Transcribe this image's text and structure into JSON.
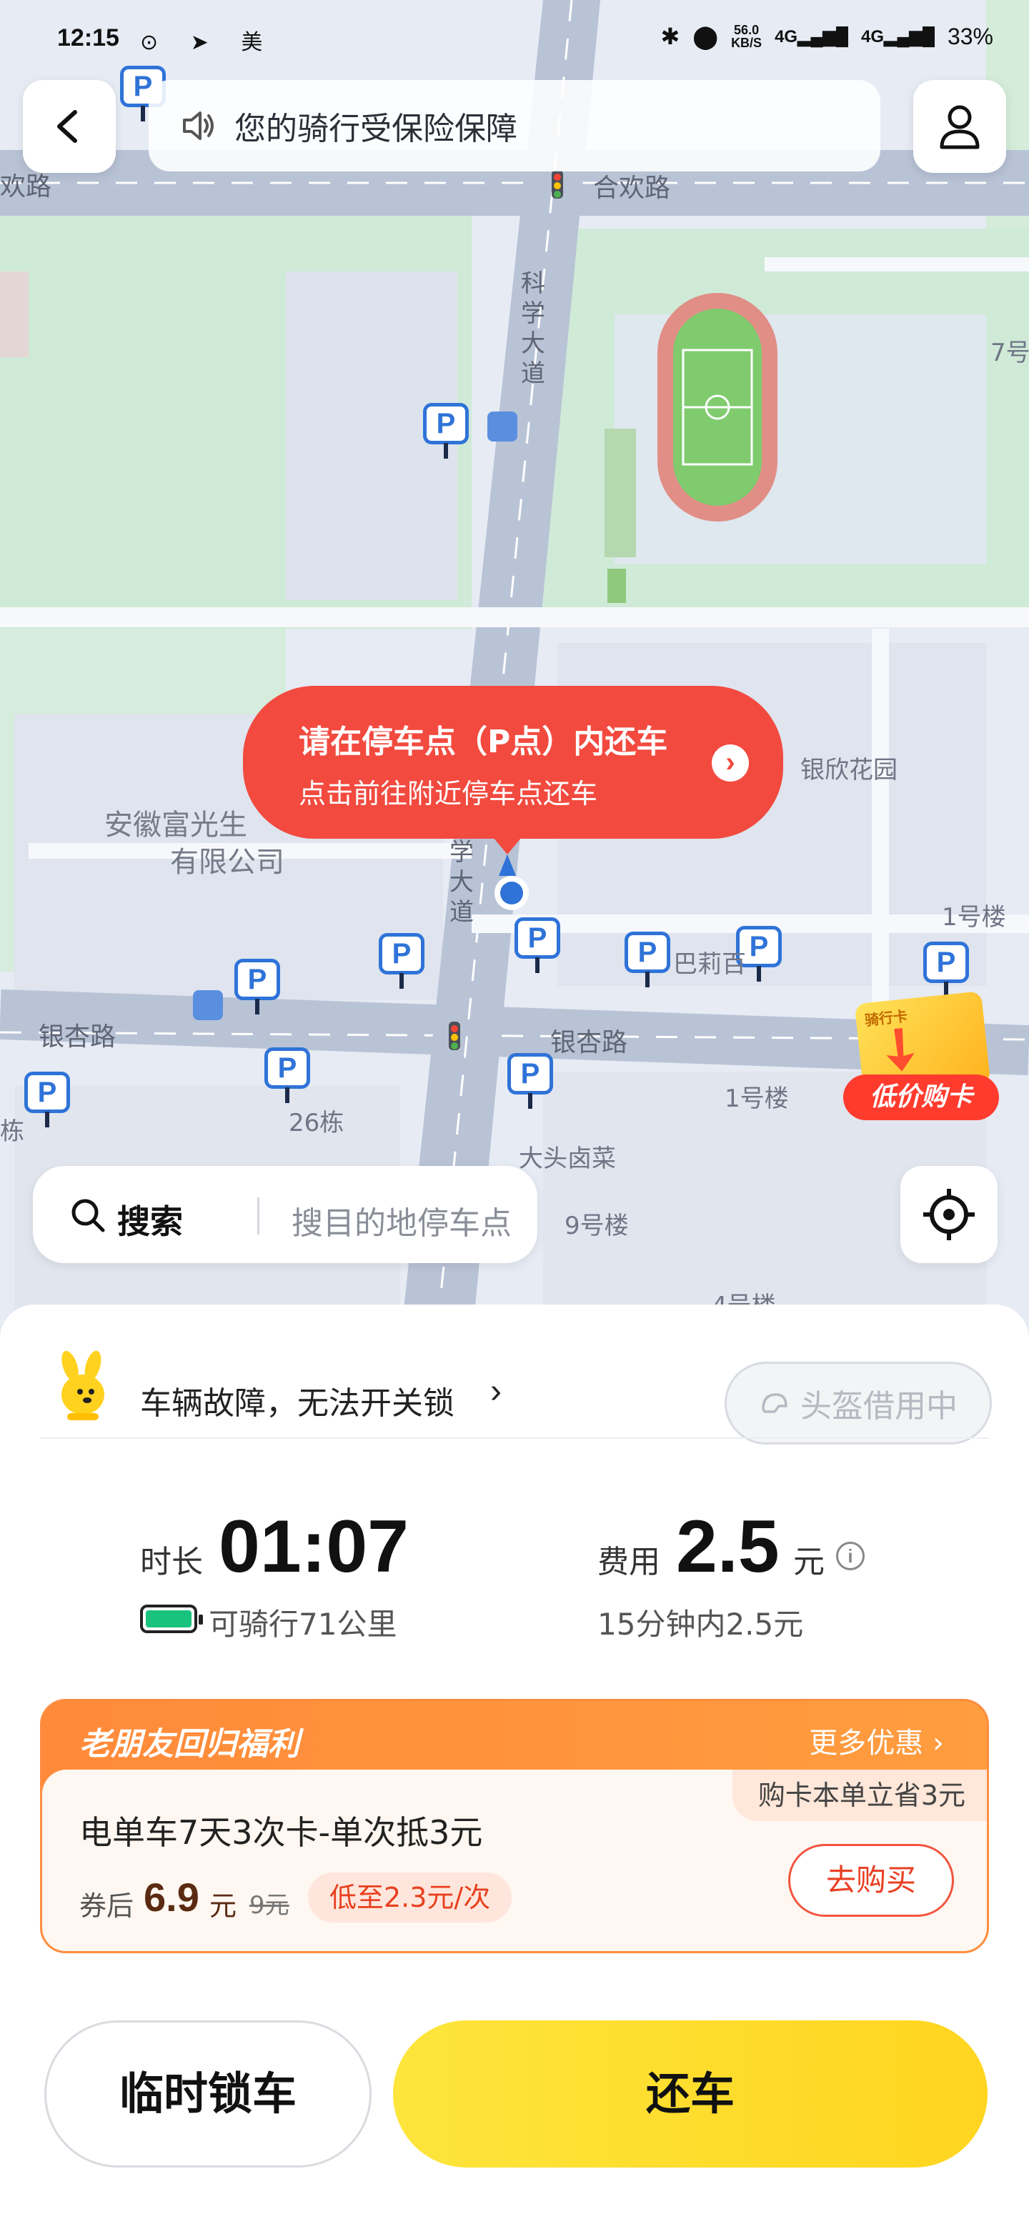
{
  "status_bar": {
    "time": "12:15",
    "app_icons": "⊙ ➤ 美",
    "net_speed": "56.0",
    "net_unit": "KB/S",
    "signal1": "4G",
    "signal2": "4G",
    "battery": "33%"
  },
  "top": {
    "notice_text": "您的骑行受保险保障"
  },
  "map": {
    "road_labels": {
      "hehuan_road": "合欢路",
      "hehuan_road_left": "欢路",
      "yinxing_road_left": "银杏路",
      "yinxing_road_center": "银杏路",
      "kexue_avenue_top": "科学大道",
      "kexue_avenue_mid": "学大道"
    },
    "place_labels": {
      "company_line1": "安徽富光生",
      "company_line2": "有限公司",
      "garden": "银欣花园",
      "bali": "巴莉百",
      "bldg_1_right": "1号楼",
      "bldg_1_lower": "1号楼",
      "bldg_26": "26栋",
      "bldg_9": "9号楼",
      "bldg_4": "4号楼",
      "bldg_7": "7号",
      "datou": "大头卤菜",
      "edge_dong": "栋"
    },
    "parking_marker_letter": "P",
    "bubble": {
      "title": "请在停车点（P点）内还车",
      "subtitle": "点击前往附近停车点还车"
    },
    "promo_card": {
      "mini_label": "骑行卡",
      "tag": "低价购卡"
    },
    "search": {
      "label": "搜索",
      "placeholder": "搜目的地停车点"
    }
  },
  "sheet": {
    "fault_text": "车辆故障，无法开关锁",
    "fault_chevron": "›",
    "helmet_status": "头盔借用中",
    "duration_label": "时长",
    "duration_value": "01:07",
    "range_text": "可骑行71公里",
    "battery_level": 1.0,
    "fee_label": "费用",
    "fee_value": "2.5",
    "fee_unit": "元",
    "fee_rule": "15分钟内2.5元",
    "promo": {
      "header": "老朋友回归福利",
      "more": "更多优惠 ›",
      "saving": "购卡本单立省3元",
      "product": "电单车7天3次卡-单次抵3元",
      "after_label": "券后",
      "price": "6.9",
      "price_unit": "元",
      "orig_price": "9元",
      "low_price": "低至2.3元/次",
      "buy_label": "去购买"
    },
    "lock_label": "临时锁车",
    "return_label": "还车"
  },
  "colors": {
    "accent_yellow": "#fde53c",
    "bubble_red": "#f24a3f",
    "parking_blue": "#2f73d8",
    "promo_orange": "#ff8a3a"
  }
}
